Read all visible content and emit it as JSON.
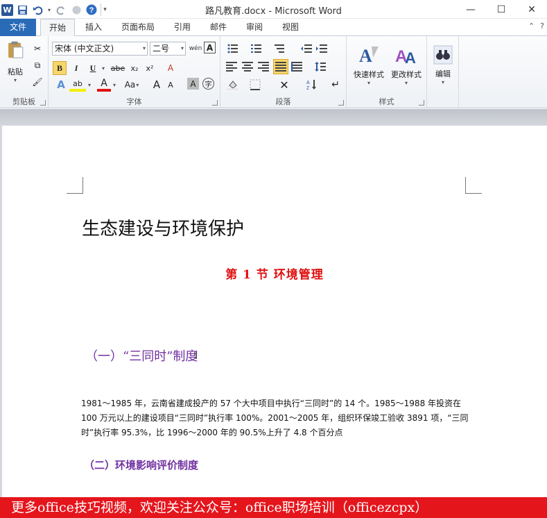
{
  "window": {
    "title": "路凡教育.docx - Microsoft Word",
    "logo_letter": "W",
    "minimize": "—",
    "maximize": "☐",
    "close": "✕"
  },
  "qat": {
    "save_icon": "💾",
    "undo_icon": "↶",
    "redo_icon": "↷",
    "repeat_icon": "◯",
    "help_icon": "?",
    "customize_icon": "▾"
  },
  "tabs": [
    {
      "label": "文件"
    },
    {
      "label": "开始"
    },
    {
      "label": "插入"
    },
    {
      "label": "页面布局"
    },
    {
      "label": "引用"
    },
    {
      "label": "邮件"
    },
    {
      "label": "审阅"
    },
    {
      "label": "视图"
    }
  ],
  "ribbon": {
    "clipboard": {
      "group_label": "剪贴板",
      "paste_label": "粘贴",
      "cut_icon": "✂",
      "copy_icon": "⧉",
      "format_painter_icon": "🖌"
    },
    "font": {
      "group_label": "字体",
      "font_name": "宋体 (中文正文)",
      "font_size": "二号",
      "phonetic_icon": "wén",
      "char_border_icon": "A",
      "bold": "B",
      "italic": "I",
      "underline": "U",
      "strikethrough": "abe",
      "subscript": "x₂",
      "superscript": "x²",
      "clear_icon": "A",
      "text_effects_icon": "A",
      "highlight_icon": "ab",
      "font_color_icon": "A",
      "change_case": "Aa",
      "grow_font": "A",
      "shrink_font": "A",
      "char_shading_icon": "A",
      "enclose_icon": "字"
    },
    "paragraph": {
      "group_label": "段落"
    },
    "styles": {
      "group_label": "样式",
      "quick_styles": "快速样式",
      "change_styles": "更改样式"
    },
    "editing": {
      "label": "编辑"
    }
  },
  "document": {
    "title": "生态建设与环境保护",
    "section_heading": "第 1 节   环境管理",
    "sub_heading_1": "（一）“三同时”制度",
    "paragraph_1": "1981～1985 年，云南省建成投产的 57 个大中项目中执行“三同时”的 14 个。1985～1988 年投资在 100 万元以上的建设项目“三同时”执行率 100%。2001～2005 年，组织环保竣工验收 3891 项，“三同时”执行率 95.3%，比 1996～2000 年的 90.5%上升了 4.8 个百分点",
    "sub_heading_2": "（二）环境影响评价制度"
  },
  "banner": {
    "text": "更多office技巧视频，欢迎关注公众号：office职场培训（officezcpx）"
  },
  "colors": {
    "file_tab": "#2a6bb8",
    "section_red": "#e01010",
    "heading_purple": "#7030a0",
    "banner_red": "#e5151c"
  }
}
